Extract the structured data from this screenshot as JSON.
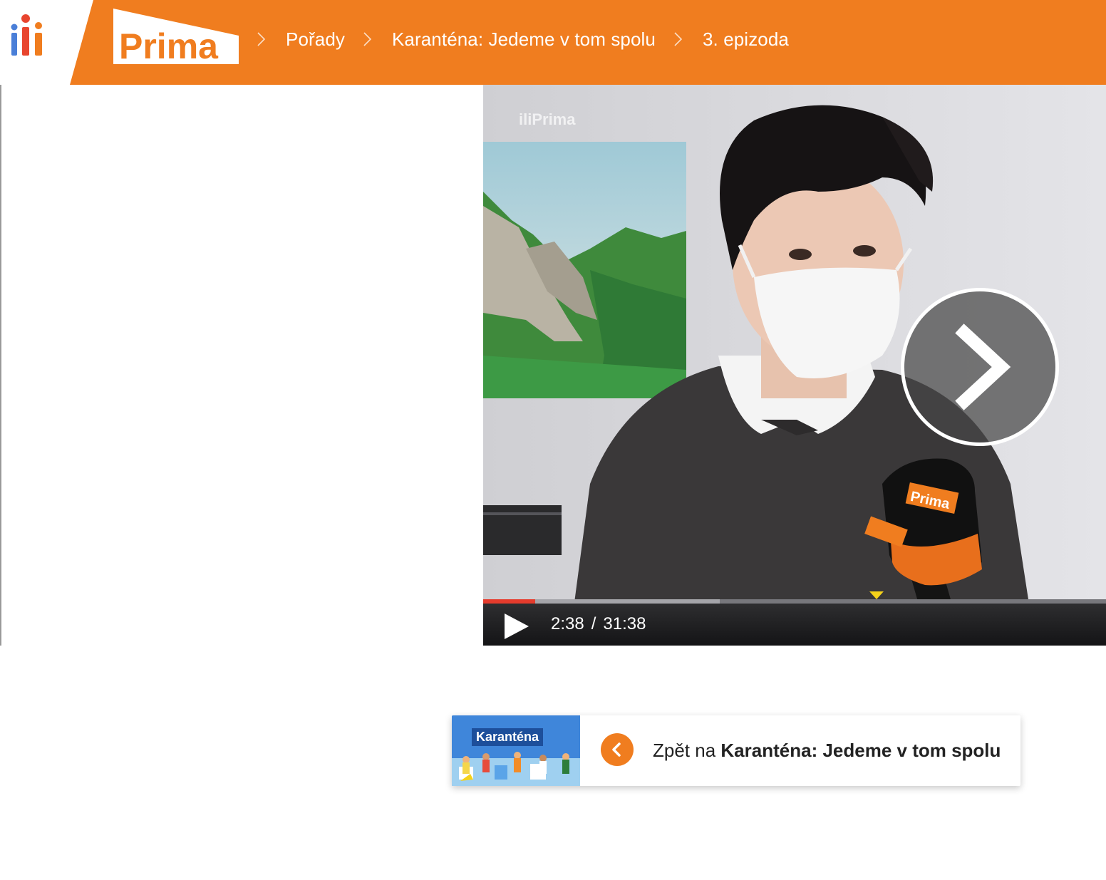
{
  "header": {
    "iprima_logo": "iPrima",
    "prima_logo": "Prima",
    "breadcrumbs": [
      {
        "label": "Pořady"
      },
      {
        "label": "Karanténa: Jedeme v tom spolu"
      },
      {
        "label": "3. epizoda"
      }
    ]
  },
  "video": {
    "watermark": "iliPrima",
    "mic_logo": "Prima",
    "next_icon": "chevron-right-icon",
    "play_icon": "play-icon",
    "current_time": "2:38",
    "separator": "/",
    "duration": "31:38",
    "progress_fraction": 0.084,
    "buffered_fraction": 0.38,
    "marker_fraction": 0.632
  },
  "back_card": {
    "thumbnail_title": "Karanténa",
    "icon": "chevron-left-icon",
    "prefix": "Zpět na",
    "show_name": "Karanténa: Jedeme v tom spolu"
  },
  "colors": {
    "brand_orange": "#f07d1f",
    "progress_red": "#e53b2c",
    "marker_yellow": "#f5d21a"
  }
}
